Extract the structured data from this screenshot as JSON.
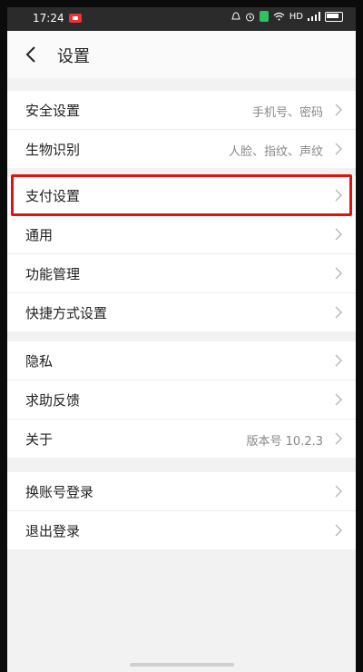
{
  "status_bar": {
    "time": "17:24",
    "network": "HD"
  },
  "header": {
    "title": "设置"
  },
  "groups": [
    {
      "items": [
        {
          "label": "安全设置",
          "value": "手机号、密码"
        },
        {
          "label": "生物识别",
          "value": "人脸、指纹、声纹"
        }
      ]
    },
    {
      "items": [
        {
          "label": "支付设置",
          "value": ""
        },
        {
          "label": "通用",
          "value": ""
        },
        {
          "label": "功能管理",
          "value": ""
        },
        {
          "label": "快捷方式设置",
          "value": ""
        }
      ]
    },
    {
      "items": [
        {
          "label": "隐私",
          "value": ""
        },
        {
          "label": "求助反馈",
          "value": ""
        },
        {
          "label": "关于",
          "value": "版本号 10.2.3"
        }
      ]
    },
    {
      "items": [
        {
          "label": "换账号登录",
          "value": ""
        },
        {
          "label": "退出登录",
          "value": ""
        }
      ]
    }
  ],
  "colors": {
    "highlight": "#e31010",
    "background": "#f2f2f2"
  }
}
